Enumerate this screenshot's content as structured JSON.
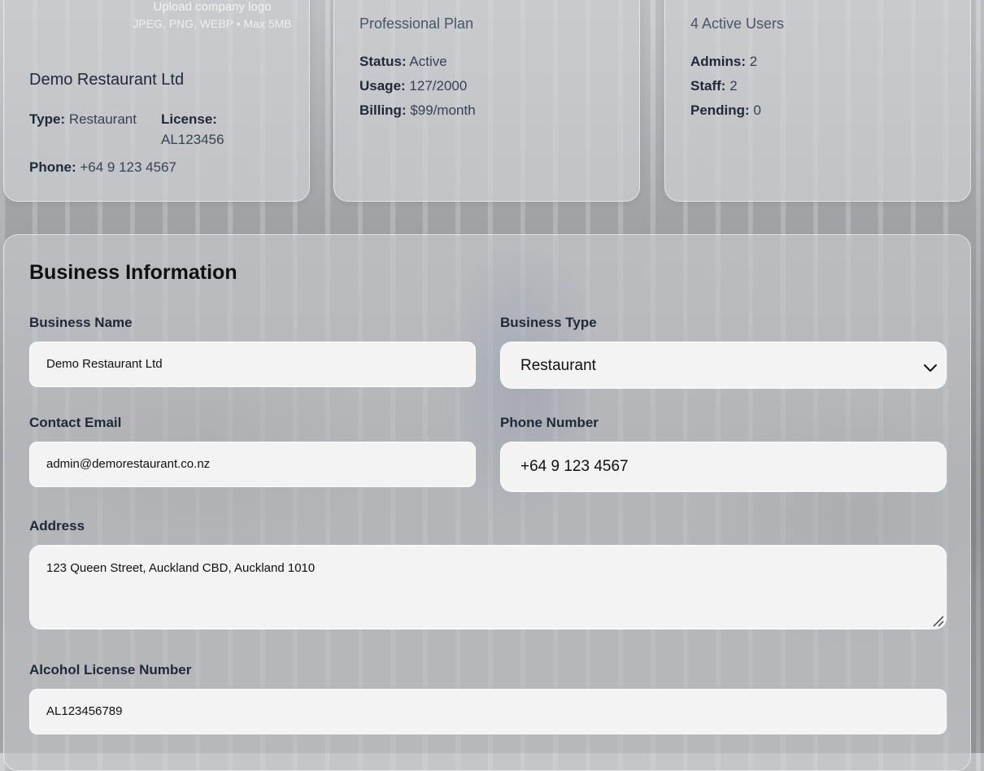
{
  "profile": {
    "upload_logo_label": "Upload company logo",
    "upload_hint": "JPEG, PNG, WEBP • Max 5MB",
    "business_name": "Demo Restaurant Ltd",
    "type_label": "Type:",
    "type_value": "Restaurant",
    "license_label": "License:",
    "license_value": "AL123456",
    "phone_label": "Phone:",
    "phone_value": "+64 9 123 4567"
  },
  "plan": {
    "title": "Professional Plan",
    "status_label": "Status:",
    "status_value": "Active",
    "usage_label": "Usage:",
    "usage_value": "127/2000",
    "billing_label": "Billing:",
    "billing_value": "$99/month"
  },
  "users": {
    "title": "4 Active Users",
    "admins_label": "Admins:",
    "admins_value": "2",
    "staff_label": "Staff:",
    "staff_value": "2",
    "pending_label": "Pending:",
    "pending_value": "0"
  },
  "form": {
    "section_title": "Business Information",
    "business_name_label": "Business Name",
    "business_name_value": "Demo Restaurant Ltd",
    "business_type_label": "Business Type",
    "business_type_value": "Restaurant",
    "contact_email_label": "Contact Email",
    "contact_email_value": "admin@demorestaurant.co.nz",
    "phone_label": "Phone Number",
    "phone_value": "+64 9 123 4567",
    "address_label": "Address",
    "address_value": "123 Queen Street, Auckland CBD, Auckland 1010",
    "license_label": "Alcohol License Number",
    "license_value": "AL123456789"
  }
}
